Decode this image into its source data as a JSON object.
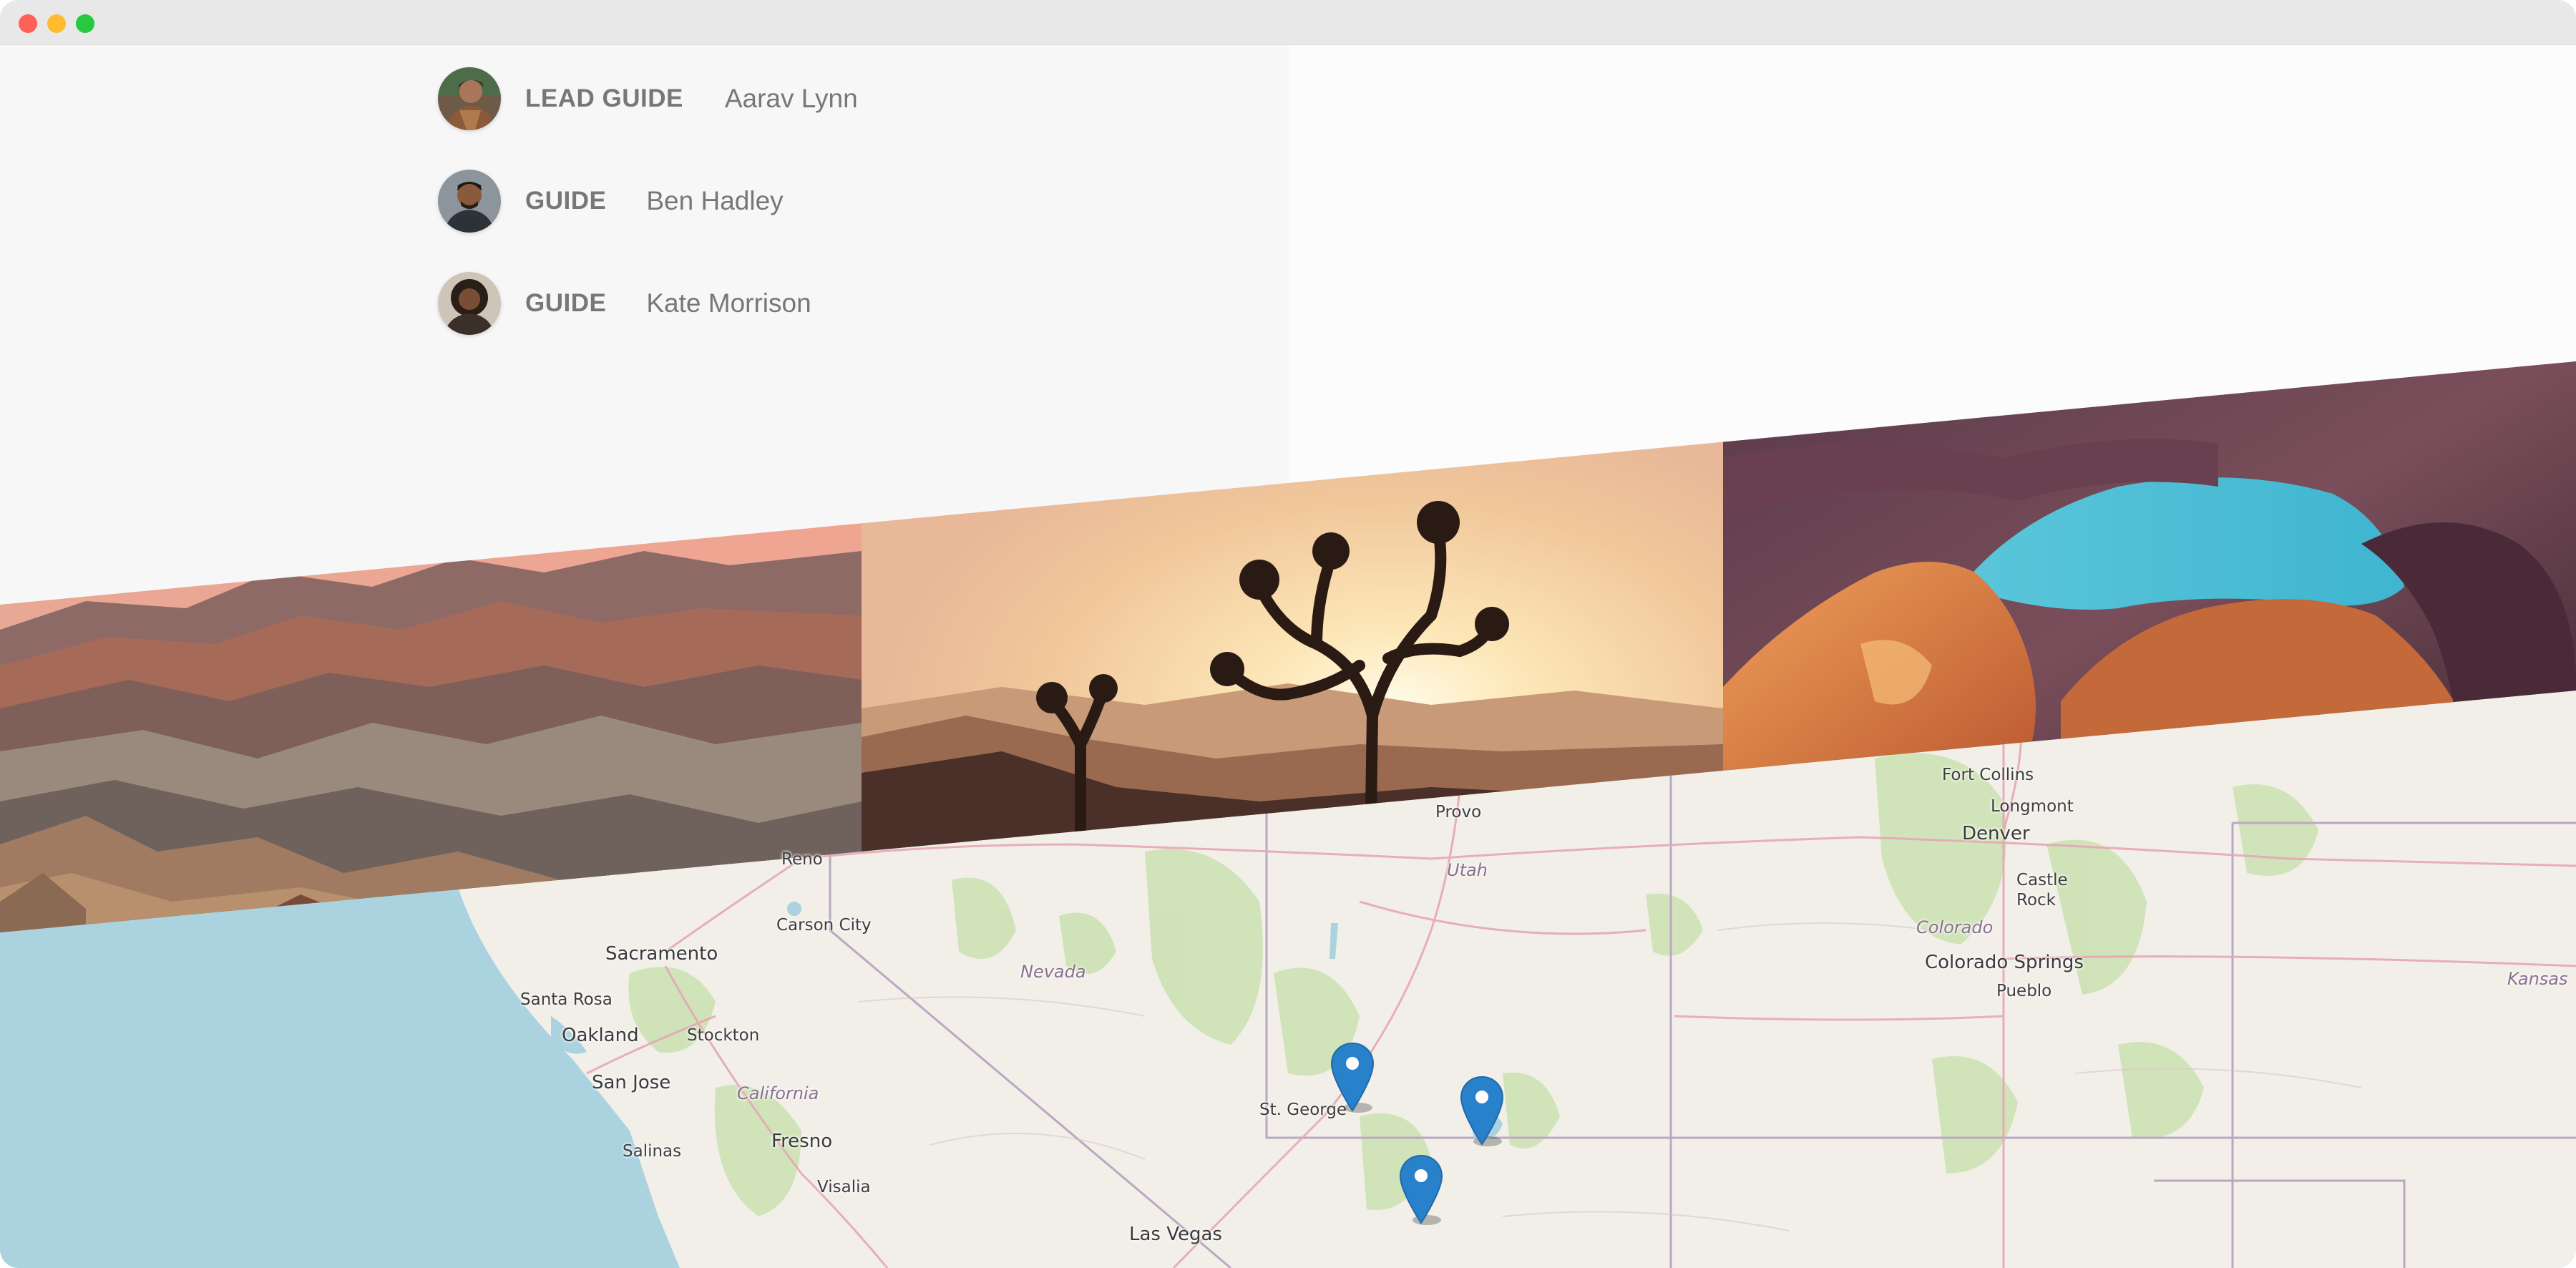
{
  "window": {
    "controls": [
      "close",
      "minimize",
      "maximize"
    ]
  },
  "guides": [
    {
      "role": "LEAD GUIDE",
      "name": "Aarav Lynn",
      "avatar": "avatar-aarav"
    },
    {
      "role": "GUIDE",
      "name": "Ben Hadley",
      "avatar": "avatar-ben"
    },
    {
      "role": "GUIDE",
      "name": "Kate Morrison",
      "avatar": "avatar-kate"
    }
  ],
  "photos": [
    {
      "name": "grand-canyon-photo"
    },
    {
      "name": "joshua-tree-sunset-photo"
    },
    {
      "name": "antelope-canyon-photo"
    }
  ],
  "map": {
    "labels": {
      "reno": "Reno",
      "carson_city": "Carson City",
      "sacramento": "Sacramento",
      "santa_rosa": "Santa Rosa",
      "oakland": "Oakland",
      "stockton": "Stockton",
      "san_jose": "San Jose",
      "california": "California",
      "salinas": "Salinas",
      "fresno": "Fresno",
      "visalia": "Visalia",
      "nevada": "Nevada",
      "las_vegas": "Las Vegas",
      "st_george": "St. George",
      "utah": "Utah",
      "provo": "Provo",
      "fort_collins": "Fort Collins",
      "longmont": "Longmont",
      "denver": "Denver",
      "castle_rock": "Castle Rock",
      "colorado": "Colorado",
      "colorado_springs": "Colorado Springs",
      "pueblo": "Pueblo",
      "kansas": "Kansas"
    },
    "pins": 3,
    "colors": {
      "water": "#aad3df",
      "land": "#f2efe9",
      "park": "#c8dfae",
      "pin": "#2a81cb"
    }
  }
}
